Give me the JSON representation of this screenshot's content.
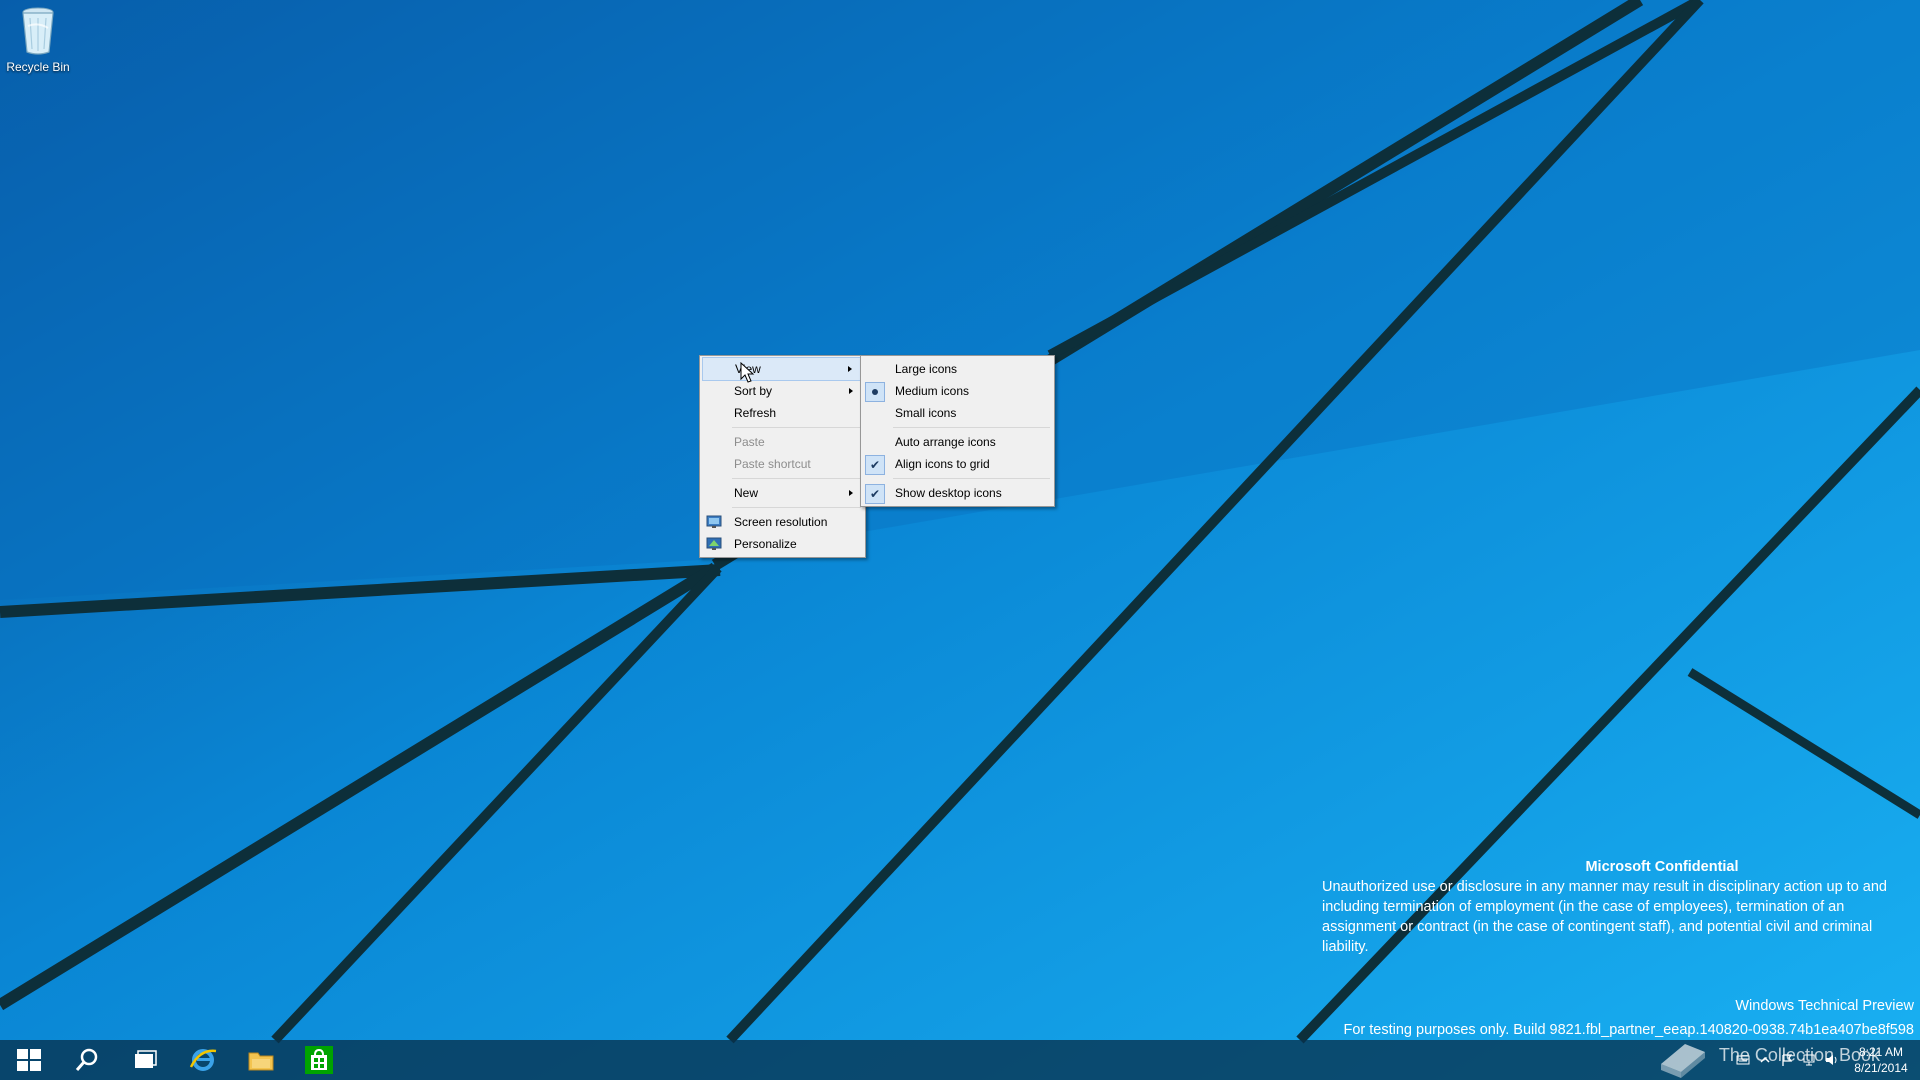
{
  "desktop": {
    "icons": [
      {
        "label": "Recycle Bin",
        "icon": "recycle-bin-icon"
      }
    ]
  },
  "context_menu": {
    "items": [
      {
        "label": "View",
        "submenu": true,
        "highlighted": true
      },
      {
        "label": "Sort by",
        "submenu": true
      },
      {
        "label": "Refresh"
      },
      {
        "separator": true
      },
      {
        "label": "Paste",
        "disabled": true
      },
      {
        "label": "Paste shortcut",
        "disabled": true
      },
      {
        "separator": true
      },
      {
        "label": "New",
        "submenu": true
      },
      {
        "separator": true
      },
      {
        "label": "Screen resolution",
        "icon": "screen-resolution-icon"
      },
      {
        "label": "Personalize",
        "icon": "personalize-icon"
      }
    ]
  },
  "view_submenu": {
    "items": [
      {
        "label": "Large icons"
      },
      {
        "label": "Medium icons",
        "state": "radio"
      },
      {
        "label": "Small icons"
      },
      {
        "separator": true
      },
      {
        "label": "Auto arrange icons"
      },
      {
        "label": "Align icons to grid",
        "state": "check"
      },
      {
        "separator": true
      },
      {
        "label": "Show desktop icons",
        "state": "check"
      }
    ]
  },
  "watermark": {
    "title": "Microsoft Confidential",
    "text": "Unauthorized use or disclosure in any manner may result in disciplinary action up to and including termination of employment (in the case of employees), termination of an assignment or contract (in the case of contingent staff), and potential civil and criminal liability.",
    "edition": "Windows Technical Preview",
    "build": "For testing purposes only. Build 9821.fbl_partner_eeap.140820-0938.74b1ea407be8f598"
  },
  "taskbar": {
    "buttons": [
      {
        "name": "start-button",
        "icon": "windows-logo-icon"
      },
      {
        "name": "search-button",
        "icon": "search-icon"
      },
      {
        "name": "task-view-button",
        "icon": "task-view-icon"
      },
      {
        "name": "internet-explorer-button",
        "icon": "internet-explorer-icon"
      },
      {
        "name": "file-explorer-button",
        "icon": "folder-icon"
      },
      {
        "name": "store-button",
        "icon": "store-icon"
      }
    ],
    "clock": {
      "time": "8:21 AM",
      "date": "8/21/2014"
    },
    "overlay_text": "The Collection Book"
  },
  "colors": {
    "wallpaper_blue": "#0a94dc",
    "menu_bg": "#f0f0f0",
    "menu_highlight": "#dbe9f8",
    "taskbar": "#08324e"
  }
}
